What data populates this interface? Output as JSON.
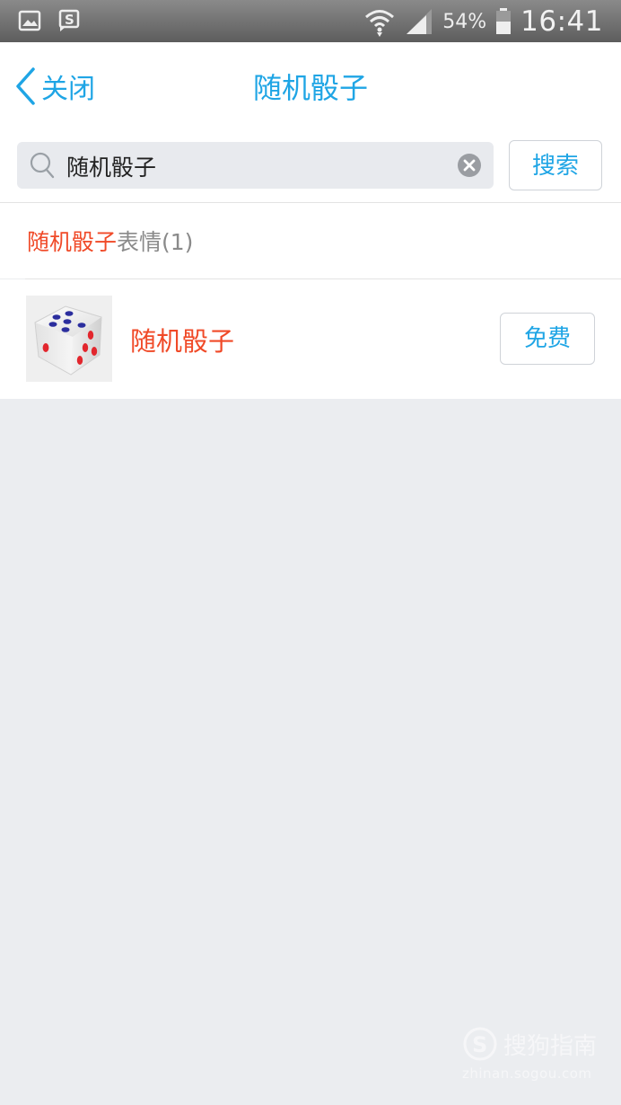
{
  "status_bar": {
    "battery_percent": "54%",
    "time": "16:41",
    "icons": [
      "gallery-icon",
      "sogou-icon",
      "wifi-icon",
      "signal-icon",
      "battery-icon"
    ]
  },
  "nav": {
    "back_label": "关闭",
    "title": "随机骰子"
  },
  "search": {
    "value": "随机骰子",
    "button_label": "搜索"
  },
  "results_section": {
    "keyword": "随机骰子",
    "suffix": "表情(1)"
  },
  "results": [
    {
      "name": "随机骰子",
      "action_label": "免费",
      "thumbnail": "dice-icon"
    }
  ],
  "watermark": {
    "brand": "搜狗指南",
    "url": "zhinan.sogou.com"
  },
  "colors": {
    "accent": "#1fa5e5",
    "highlight": "#f04a28",
    "background": "#ebedf0"
  }
}
